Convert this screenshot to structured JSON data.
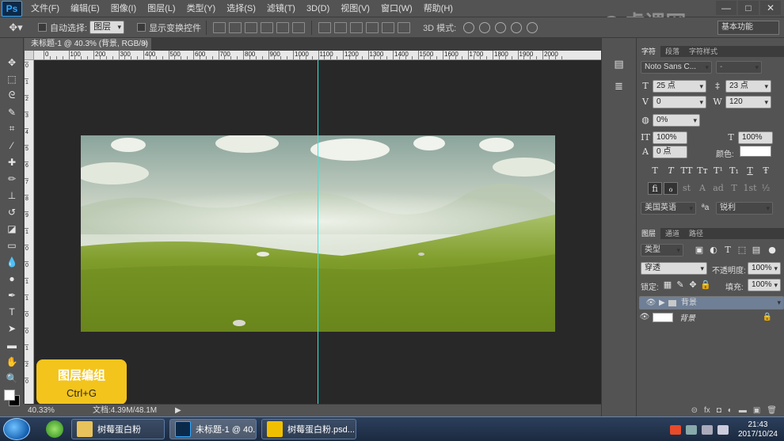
{
  "app": {
    "logo": "Ps"
  },
  "menu": [
    "文件(F)",
    "编辑(E)",
    "图像(I)",
    "图层(L)",
    "类型(Y)",
    "选择(S)",
    "滤镜(T)",
    "3D(D)",
    "视图(V)",
    "窗口(W)",
    "帮助(H)"
  ],
  "window_buttons": [
    "—",
    "□",
    "✕"
  ],
  "options": {
    "auto_select_label": "自动选择:",
    "auto_select_value": "图层",
    "transform_label": "显示变换控件",
    "mode3d_label": "3D 模式:",
    "workspace": "基本功能"
  },
  "document": {
    "tab_title": "未标题-1 @ 40.3% (背景, RGB/8) *",
    "tab_close": "×",
    "zoom": "40.33%",
    "doc_info": "文档:4.39M/48.1M",
    "arrow": "▶"
  },
  "ruler_h_labels": [
    "0",
    "100",
    "200",
    "300",
    "400",
    "500",
    "600",
    "700",
    "800",
    "900",
    "1000",
    "1100",
    "1200",
    "1300",
    "1400",
    "1500",
    "1600",
    "1700",
    "1800",
    "1900",
    "2000"
  ],
  "ruler_v_labels": [
    "0",
    "1",
    "2",
    "3",
    "4",
    "5",
    "6",
    "7",
    "8",
    "9",
    "1",
    "0",
    "0",
    "1",
    "1",
    "0",
    "0",
    "1",
    "2",
    "0"
  ],
  "card": {
    "title": "图层编组",
    "shortcut": "Ctrl+G"
  },
  "character_panel": {
    "tabs": [
      "字符",
      "段落",
      "字符样式"
    ],
    "font_family": "Noto Sans C...",
    "font_style": "-",
    "font_size": "25 点",
    "leading": "23 点",
    "kerning": "0",
    "tracking": "120",
    "scale_percent": "0%",
    "vertical_scale": "100%",
    "horizontal_scale": "100%",
    "baseline_shift": "0 点",
    "color_label": "颜色:",
    "style_buttons": [
      "T",
      "T",
      "TT",
      "Tт",
      "T¹",
      "T₁",
      "T",
      "Ŧ"
    ],
    "opentype_buttons": [
      "fi",
      "ℴ",
      "st",
      "A",
      "ad",
      "T",
      "1st",
      "½"
    ],
    "language": "美国英语",
    "aa_icon": "ªa",
    "antialias": "锐利"
  },
  "layers_panel": {
    "tabs": [
      "图层",
      "通道",
      "路径"
    ],
    "filter_kind": "类型",
    "blend_mode": "穿透",
    "opacity_label": "不透明度:",
    "opacity": "100%",
    "lock_label": "锁定:",
    "fill_label": "填充:",
    "fill": "100%",
    "layers": [
      {
        "name": "背景",
        "type": "group",
        "selected": true
      },
      {
        "name": "背景",
        "type": "background",
        "selected": false
      }
    ],
    "footer_icons": [
      "⊝",
      "fx",
      "◘",
      "◐",
      "▬",
      "▣",
      "🗑"
    ]
  },
  "taskbar": {
    "items": [
      {
        "label": "树莓蛋白粉",
        "color": "#e8c25a"
      },
      {
        "label": "未标题-1 @ 40.3...",
        "color": "#0b2a4a",
        "active": true
      },
      {
        "label": "树莓蛋白粉.psd...",
        "color": "#f0c000"
      }
    ],
    "time": "21:43",
    "date": "2017/10/24"
  },
  "watermark": {
    "text": "虎课网",
    "mark": "e"
  }
}
